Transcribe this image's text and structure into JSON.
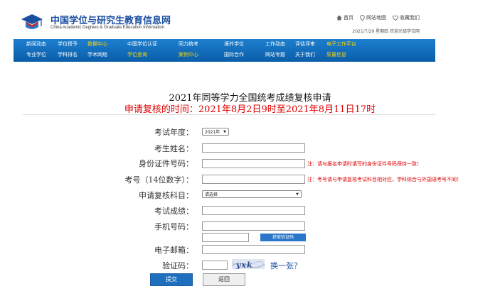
{
  "header": {
    "site_title": "中国学位与研究生教育信息网",
    "site_subtitle": "China Academic Degrees & Graduate Education Information",
    "links": {
      "home": "首页",
      "sitemap": "网站地图",
      "favorite": "收藏我们"
    },
    "date_line": "2021/7/29 星期四  欢迎光临学位网"
  },
  "nav": {
    "row1": [
      {
        "label": "新闻动态",
        "highlight": false
      },
      {
        "label": "学位授予",
        "highlight": false
      },
      {
        "label": "数据中心",
        "highlight": true
      },
      {
        "label": "中国学位认证",
        "highlight": false
      },
      {
        "label": "同力统考",
        "highlight": false
      },
      {
        "label": "境外学位",
        "highlight": false
      },
      {
        "label": "工作动态",
        "highlight": false
      },
      {
        "label": "评估评审",
        "highlight": false
      },
      {
        "label": "电子工作平台",
        "highlight": true
      }
    ],
    "row2": [
      {
        "label": "专业学位",
        "highlight": false
      },
      {
        "label": "学科排名",
        "highlight": false
      },
      {
        "label": "学术网络",
        "highlight": false
      },
      {
        "label": "学位查询",
        "highlight": true
      },
      {
        "label": "案例中心",
        "highlight": true
      },
      {
        "label": "国际合作",
        "highlight": false
      },
      {
        "label": "网站专题",
        "highlight": false
      },
      {
        "label": "关于我们",
        "highlight": false
      },
      {
        "label": "质量信息",
        "highlight": true
      }
    ],
    "highlight_color": "#ffd800"
  },
  "form": {
    "title": "2021年同等学力全国统考成绩复核申请",
    "subtitle": "申请复核的时间：2021年8月2日9时至2021年8月11日17时",
    "fields": {
      "exam_year": {
        "label": "考试年度：",
        "value": "2021年"
      },
      "name": {
        "label": "考生姓名：",
        "value": ""
      },
      "id_number": {
        "label": "身份证件号码：",
        "value": "",
        "note": "注：请与报名申请时填写的身份证件号码保持一致！"
      },
      "exam_number": {
        "label": "考号（14位数字）：",
        "value": "",
        "note": "注：考号请与申请复核考试科目相对应，学科综合与外国语考号不同！"
      },
      "subject": {
        "label": "申请复核科目：",
        "value": "请选择"
      },
      "score": {
        "label": "考试成绩：",
        "value": ""
      },
      "phone": {
        "label": "手机号码：",
        "value": ""
      },
      "sms_code": {
        "value": "",
        "button": "获取验证码"
      },
      "email": {
        "label": "电子邮箱：",
        "value": ""
      },
      "captcha": {
        "label": "验证码：",
        "value": "",
        "image_text": "yxk",
        "refresh": "换一张？"
      }
    },
    "buttons": {
      "submit": "提交",
      "back": "返回"
    }
  },
  "colors": {
    "brand_blue": "#1b4fa0",
    "nav_blue": "#0a5da8",
    "alert_red": "#e00000"
  }
}
